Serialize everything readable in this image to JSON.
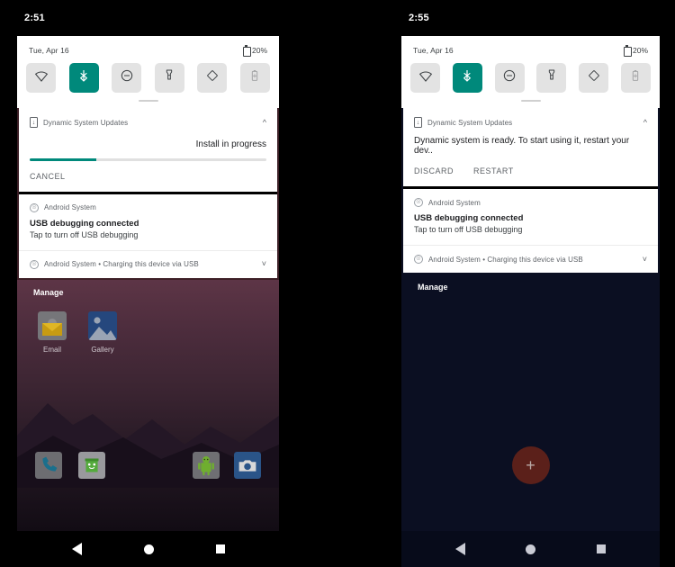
{
  "colors": {
    "accent_teal": "#00897b",
    "tile_bg": "#e3e3e3",
    "left_shade_border": "#3c1f26",
    "right_shade_border": "#0b0f22",
    "right_body_bg": "#0b0f22",
    "fab_bg": "#5b201a"
  },
  "left_phone": {
    "status_bar": {
      "clock": "2:51"
    },
    "quick_settings": {
      "date": "Tue, Apr 16",
      "battery_percent": "20%",
      "tiles": [
        {
          "name": "wifi",
          "state": "off"
        },
        {
          "name": "bluetooth",
          "state": "on"
        },
        {
          "name": "do-not-disturb",
          "state": "off"
        },
        {
          "name": "flashlight",
          "state": "off"
        },
        {
          "name": "auto-rotate",
          "state": "off"
        },
        {
          "name": "battery-saver",
          "state": "disabled"
        }
      ]
    },
    "notifications": {
      "dsu": {
        "app": "Dynamic System Updates",
        "status": "Install in progress",
        "progress_percent": 28,
        "actions": [
          "CANCEL"
        ]
      },
      "usb_debug": {
        "app": "Android System",
        "title": "USB debugging connected",
        "subtitle": "Tap to turn off USB debugging"
      },
      "charging": {
        "text": "Android System • Charging this device via USB"
      }
    },
    "home": {
      "manage_label": "Manage",
      "apps": [
        {
          "label": "Email",
          "icon": "email-icon"
        },
        {
          "label": "Gallery",
          "icon": "gallery-icon"
        }
      ],
      "dock": [
        {
          "icon": "phone-icon"
        },
        {
          "icon": "messaging-icon"
        },
        {
          "icon": "android-icon"
        },
        {
          "icon": "camera-icon"
        }
      ]
    },
    "nav_bar": {
      "back": "back-icon",
      "home": "home-icon",
      "recents": "recents-icon"
    }
  },
  "right_phone": {
    "status_bar": {
      "clock": "2:55"
    },
    "quick_settings": {
      "date": "Tue, Apr 16",
      "battery_percent": "20%",
      "tiles": [
        {
          "name": "wifi",
          "state": "off"
        },
        {
          "name": "bluetooth",
          "state": "on"
        },
        {
          "name": "do-not-disturb",
          "state": "off"
        },
        {
          "name": "flashlight",
          "state": "off"
        },
        {
          "name": "auto-rotate",
          "state": "off"
        },
        {
          "name": "battery-saver",
          "state": "disabled"
        }
      ]
    },
    "notifications": {
      "dsu": {
        "app": "Dynamic System Updates",
        "message": "Dynamic system is ready. To start using it, restart your dev..",
        "actions": [
          "DISCARD",
          "RESTART"
        ]
      },
      "usb_debug": {
        "app": "Android System",
        "title": "USB debugging connected",
        "subtitle": "Tap to turn off USB debugging"
      },
      "charging": {
        "text": "Android System • Charging this device via USB"
      }
    },
    "home": {
      "manage_label": "Manage",
      "fab_label": "+"
    },
    "nav_bar": {
      "back": "back-icon",
      "home": "home-icon",
      "recents": "recents-icon"
    }
  }
}
